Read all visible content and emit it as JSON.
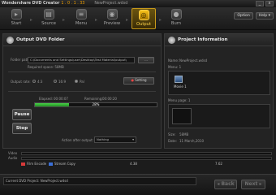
{
  "window": {
    "app_name": "Wondershare DVD Creator",
    "version": "1 . 0 . 1 . 33",
    "project": "NewProject.wdsd",
    "minimize": "_",
    "close": "x"
  },
  "toolbar": {
    "steps": [
      {
        "label": "Start",
        "icon": "play-icon"
      },
      {
        "label": "Source",
        "icon": "film-icon"
      },
      {
        "label": "Menu",
        "icon": "menu-icon"
      },
      {
        "label": "Preview",
        "icon": "eye-icon"
      },
      {
        "label": "Output",
        "icon": "disc-icon"
      },
      {
        "label": "Burn",
        "icon": "burn-icon"
      }
    ],
    "active_step": "Output",
    "extra_button": "Option",
    "help_button": "Help ▾"
  },
  "output_panel": {
    "title": "Output DVD Folder",
    "folder_path_label": "Folder path:",
    "folder_path_value": "C:\\Documents and Settings\\user\\Desktop\\Test Material\\output\\",
    "browse_button": "...",
    "free_space_label": "Required space: 58MB",
    "output_rate_label": "Output rate:",
    "rate_options": [
      "4:3",
      "16:9",
      "Pal"
    ],
    "rate_selected": "Pal",
    "rate_button": "Setting",
    "elapsed_label": "Elapsed:",
    "elapsed_value": "00:00:07",
    "remaining_label": "Remaining:",
    "remaining_value": "00:00:20",
    "progress_percent": 28,
    "progress_text": "28%",
    "pause_button": "Pause",
    "stop_button": "Stop",
    "action_after_label": "Action after output:",
    "action_after_value": "Nothing"
  },
  "project_panel": {
    "title": "Project Information",
    "name_label": "Name:",
    "name_value": "NewProject.wdsd",
    "menu_label": "Menu: 1",
    "menu_item": "Movie 1",
    "menu_page_label": "Menu page: 1",
    "size_label": "Size:",
    "size_value": "58MB",
    "date_label": "Date:",
    "date_value": "11 March,2010"
  },
  "timeline": {
    "video_label": "Video",
    "audio_label": "Audio",
    "ticks": [
      "4.38",
      "7.62"
    ],
    "legend": [
      {
        "label": "Film Encode",
        "color": "#d83a3a"
      },
      {
        "label": "Stream Copy",
        "color": "#3a6fd8"
      }
    ]
  },
  "status": {
    "text": "Current DVD Project: NewProject.wdsd",
    "back_button": "Back",
    "next_button": "Next"
  }
}
